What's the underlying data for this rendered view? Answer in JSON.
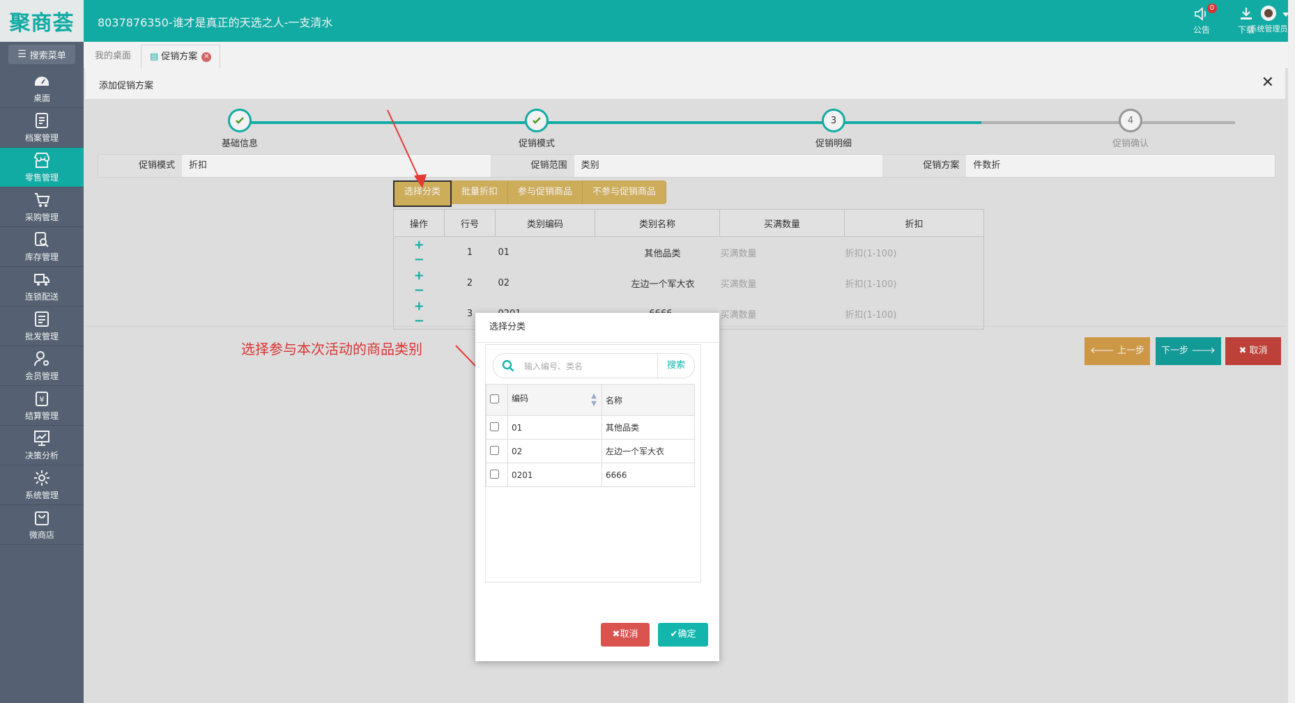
{
  "header": {
    "logo_text": "聚商荟",
    "title": "8037876350-谁才是真正的天选之人-一支清水",
    "notice_label": "公告",
    "notice_badge": "0",
    "download_label": "下载",
    "user_label": "系统管理员"
  },
  "sidebar": {
    "search_label": "搜索菜单",
    "items": [
      {
        "label": "桌面",
        "icon": "dashboard-icon"
      },
      {
        "label": "档案管理",
        "icon": "file-icon"
      },
      {
        "label": "零售管理",
        "icon": "store-icon"
      },
      {
        "label": "采购管理",
        "icon": "cart-icon"
      },
      {
        "label": "库存管理",
        "icon": "inventory-search-icon"
      },
      {
        "label": "连锁配送",
        "icon": "truck-icon"
      },
      {
        "label": "批发管理",
        "icon": "wholesale-icon"
      },
      {
        "label": "会员管理",
        "icon": "member-icon"
      },
      {
        "label": "结算管理",
        "icon": "settlement-icon"
      },
      {
        "label": "决策分析",
        "icon": "chart-icon"
      },
      {
        "label": "系统管理",
        "icon": "gear-icon"
      },
      {
        "label": "微商店",
        "icon": "shop-bag-icon"
      }
    ],
    "active_index": 2
  },
  "tabs": {
    "home": "我的桌面",
    "current": "促销方案"
  },
  "page": {
    "title": "添加促销方案"
  },
  "steps": [
    {
      "label": "基础信息",
      "number": "1",
      "done": true
    },
    {
      "label": "促销模式",
      "number": "2",
      "done": true
    },
    {
      "label": "促销明细",
      "number": "3",
      "done": false,
      "current": true
    },
    {
      "label": "促销确认",
      "number": "4",
      "done": false
    }
  ],
  "info": {
    "mode_key": "促销模式",
    "mode_val": "折扣",
    "scope_key": "促销范围",
    "scope_val": "类别",
    "plan_key": "促销方案",
    "plan_val": "件数折"
  },
  "actions": {
    "select_category": "选择分类",
    "batch_discount": "批量折扣",
    "include_goods": "参与促销商品",
    "exclude_goods": "不参与促销商品"
  },
  "table": {
    "headers": [
      "操作",
      "行号",
      "类别编码",
      "类别名称",
      "买满数量",
      "折扣"
    ],
    "rows": [
      {
        "no": "1",
        "code": "01",
        "name": "其他品类",
        "qty_ph": "买满数量",
        "disc_ph": "折扣(1-100)"
      },
      {
        "no": "2",
        "code": "02",
        "name": "左边一个军大衣",
        "qty_ph": "买满数量",
        "disc_ph": "折扣(1-100)"
      },
      {
        "no": "3",
        "code": "0201",
        "name": "6666",
        "qty_ph": "买满数量",
        "disc_ph": "折扣(1-100)"
      }
    ],
    "plus": "+",
    "minus": "−"
  },
  "nav_buttons": {
    "prev": "上一步",
    "next": "下一步",
    "cancel": "取消"
  },
  "annotation": "选择参与本次活动的商品类别",
  "modal": {
    "title": "选择分类",
    "search_placeholder": "输入编号、类名",
    "search_button": "搜索",
    "col_code": "编码",
    "col_name": "名称",
    "rows": [
      {
        "code": "01",
        "name": "其他品类"
      },
      {
        "code": "02",
        "name": "左边一个军大衣"
      },
      {
        "code": "0201",
        "name": "6666"
      }
    ],
    "cancel": "取消",
    "ok": "确定"
  },
  "colors": {
    "primary": "#13b5ad",
    "sidebar": "#5a6779",
    "gold": "#d9b65f",
    "danger": "#d9534f",
    "annotation": "#e53935"
  }
}
